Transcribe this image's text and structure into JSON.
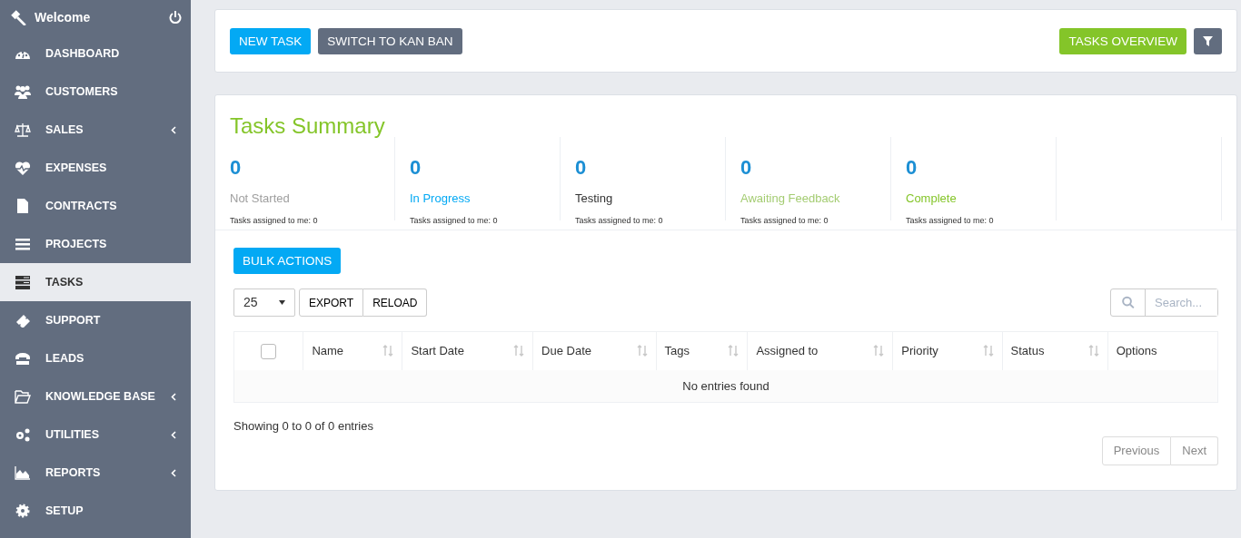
{
  "sidebar": {
    "title": "Welcome",
    "items": [
      {
        "label": "DASHBOARD",
        "selected": false,
        "has_submenu": false
      },
      {
        "label": "CUSTOMERS",
        "selected": false,
        "has_submenu": false
      },
      {
        "label": "SALES",
        "selected": false,
        "has_submenu": true
      },
      {
        "label": "EXPENSES",
        "selected": false,
        "has_submenu": false
      },
      {
        "label": "CONTRACTS",
        "selected": false,
        "has_submenu": false
      },
      {
        "label": "PROJECTS",
        "selected": false,
        "has_submenu": false
      },
      {
        "label": "TASKS",
        "selected": true,
        "has_submenu": false
      },
      {
        "label": "SUPPORT",
        "selected": false,
        "has_submenu": false
      },
      {
        "label": "LEADS",
        "selected": false,
        "has_submenu": false
      },
      {
        "label": "KNOWLEDGE BASE",
        "selected": false,
        "has_submenu": true
      },
      {
        "label": "UTILITIES",
        "selected": false,
        "has_submenu": true
      },
      {
        "label": "REPORTS",
        "selected": false,
        "has_submenu": true
      },
      {
        "label": "SETUP",
        "selected": false,
        "has_submenu": false
      }
    ]
  },
  "toolbar": {
    "left_buttons": [
      {
        "label": "NEW TASK",
        "kind": "info"
      },
      {
        "label": "SWITCH TO KAN BAN",
        "kind": "default"
      }
    ],
    "right_buttons": [
      {
        "label": "TASKS OVERVIEW",
        "kind": "success"
      }
    ]
  },
  "summary": {
    "title": "Tasks Summary",
    "statuses": [
      {
        "count": "0",
        "label": "Not Started",
        "color": "#9e9e9e",
        "mine": "Tasks assigned to me: 0"
      },
      {
        "count": "0",
        "label": "In Progress",
        "color": "#03a9f4",
        "mine": "Tasks assigned to me: 0"
      },
      {
        "count": "0",
        "label": "Testing",
        "color": "#333333",
        "mine": "Tasks assigned to me: 0"
      },
      {
        "count": "0",
        "label": "Awaiting Feedback",
        "color": "#a4cc72",
        "mine": "Tasks assigned to me: 0"
      },
      {
        "count": "0",
        "label": "Complete",
        "color": "#84c529",
        "mine": "Tasks assigned to me: 0"
      }
    ]
  },
  "bulk_button": "BULK ACTIONS",
  "page_length": "25",
  "table_buttons": [
    "EXPORT",
    "RELOAD"
  ],
  "search": {
    "placeholder": "Search..."
  },
  "table": {
    "select_all": {
      "checked": false
    },
    "columns": [
      {
        "label": "Name",
        "sortable": true
      },
      {
        "label": "Start Date",
        "sortable": true
      },
      {
        "label": "Due Date",
        "sortable": true
      },
      {
        "label": "Tags",
        "sortable": true
      },
      {
        "label": "Assigned to",
        "sortable": true
      },
      {
        "label": "Priority",
        "sortable": true
      },
      {
        "label": "Status",
        "sortable": true
      },
      {
        "label": "Options",
        "sortable": false
      }
    ],
    "empty_message": "No entries found"
  },
  "info": "Showing 0 to 0 of 0 entries",
  "pagination": [
    {
      "label": "Previous",
      "disabled": true
    },
    {
      "label": "Next",
      "disabled": true
    }
  ]
}
